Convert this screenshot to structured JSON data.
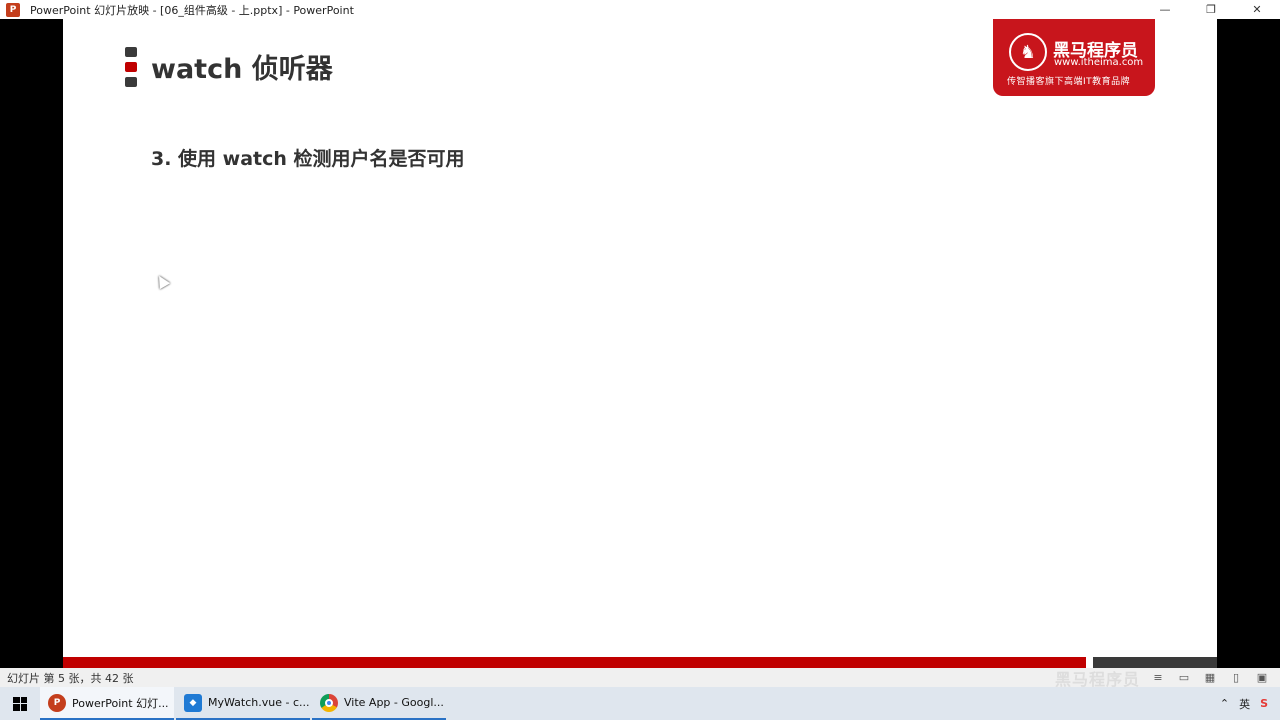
{
  "window": {
    "title": "PowerPoint 幻灯片放映 - [06_组件高级 - 上.pptx] - PowerPoint",
    "app_icon_letter": "P",
    "controls": {
      "minimize": "—",
      "restore": "❐",
      "close": "✕"
    }
  },
  "slide": {
    "title": "watch 侦听器",
    "point": "3. 使用 watch 检测用户名是否可用",
    "logo": {
      "name": "黑马程序员",
      "url": "www.itheima.com",
      "slogan": "传智播客旗下高端IT教育品牌"
    }
  },
  "statusbar": {
    "slide_counter": "幻灯片 第 5 张，共 42 张",
    "watermark": "黑马程序员"
  },
  "taskbar": {
    "items": [
      {
        "label": "PowerPoint 幻灯...",
        "icon": "powerpoint-icon",
        "color": "#c43e1c"
      },
      {
        "label": "MyWatch.vue - c...",
        "icon": "vscode-icon",
        "color": "#1f7ad4"
      },
      {
        "label": "Vite App - Googl...",
        "icon": "chrome-icon",
        "color": "#4caf50"
      }
    ],
    "ime_label": "英",
    "tray_chevron": "⌃"
  },
  "colors": {
    "brand_red": "#c8151c",
    "accent_red": "#c00000",
    "dark_gray": "#3a3a3a"
  }
}
